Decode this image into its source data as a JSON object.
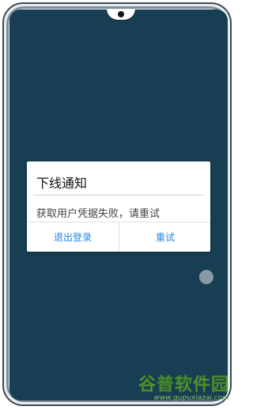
{
  "dialog": {
    "title": "下线通知",
    "message": "获取用户凭据失败，请重试",
    "buttons": {
      "logout": "退出登录",
      "retry": "重试"
    }
  },
  "watermark": {
    "logo": "谷普软件园",
    "url": "www.gupuxiazai.com"
  },
  "colors": {
    "screen_bg": "#173e52",
    "button_text": "#1e88e5"
  }
}
